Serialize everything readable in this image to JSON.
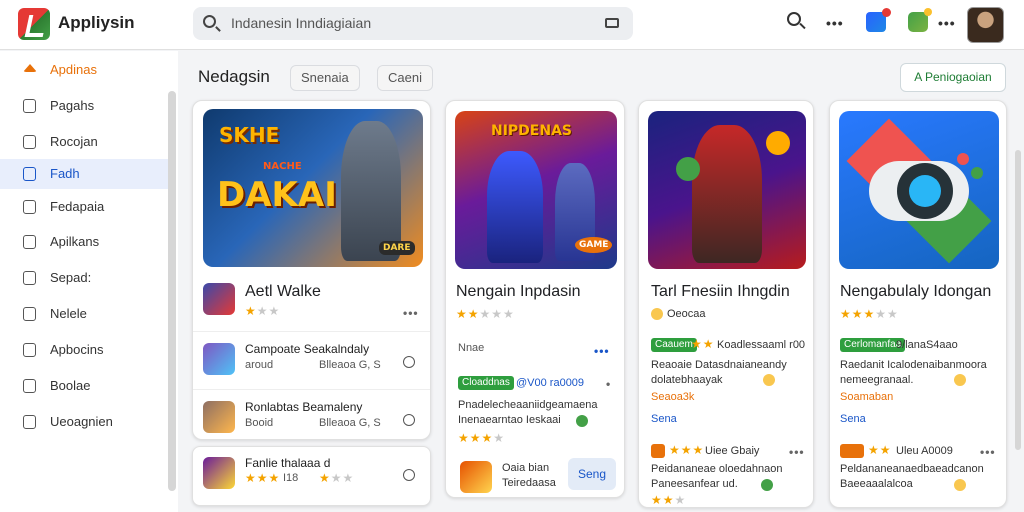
{
  "app": {
    "name": "Appliysin"
  },
  "search": {
    "value": "Indanesin Inndiagiaian"
  },
  "sidebar": {
    "items": [
      {
        "label": "Apdinas"
      },
      {
        "label": "Pagahs"
      },
      {
        "label": "Rocojan"
      },
      {
        "label": "Fadh"
      },
      {
        "label": "Fedapaia"
      },
      {
        "label": "Apilkans"
      },
      {
        "label": "Sepad:"
      },
      {
        "label": "Nelele"
      },
      {
        "label": "Apbocins"
      },
      {
        "label": "Boolae"
      },
      {
        "label": "Ueoagnien"
      }
    ]
  },
  "main": {
    "title": "Nedagsin",
    "chips": [
      "Snenaia",
      "Caeni"
    ],
    "create_button": "A Peniogaoian"
  },
  "cards": [
    {
      "banner_title": "DAKAI",
      "banner_tag": "SKHE",
      "banner_sub": "NACHE",
      "corner": "DARE",
      "title": "Aetl Walke",
      "rows": [
        {
          "title": "Campoate Seakalndaly",
          "sub1": "aroud",
          "sub2": "Blleaoa G, S"
        },
        {
          "title": "Ronlabtas Beamaleny",
          "sub1": "Booid",
          "sub2": "Blleaoa G, S"
        },
        {
          "title": "Fanlie thalaaa d",
          "sub1": "I18",
          "sub2": ""
        }
      ]
    },
    {
      "banner_title": "NIPDENAS",
      "corner": "GAME",
      "title": "Nengain Inpdasin",
      "meta": "Nnae",
      "badge": "Cloaddnas",
      "badge_info": "@V00 ra0009",
      "desc1": "Pnadelecheaaniidgeamaena",
      "desc2": "Inenaearntao Ieskaai",
      "bottom_text1": "Oaia bian",
      "bottom_text2": "Teiredaasa",
      "install": "Seng"
    },
    {
      "title": "Tarl Fnesiin Ihngdin",
      "meta": "Oeocaa",
      "badge": "Caauem",
      "badge_info": "Koadlessaaml r00",
      "desc1": "Reaoaie Datasdnaianeandy",
      "desc2": "dolatebhaayak",
      "link": "Seaoa3k",
      "link2": "Sena",
      "bottom_badge": "",
      "bottom_info": "Uiee Gbaiy",
      "bottom_desc1": "Peidananeae oloedahnaon",
      "bottom_desc2": "Paneesanfear ud."
    },
    {
      "title": "Nengabulaly Idongan",
      "badge": "Cerlomanfaa",
      "badge_info": "9/lanaS4aao",
      "desc1": "Raedanit Icalodenaibanmoora",
      "desc2": "nemeegranaal.",
      "link": "Soamaban",
      "link2": "Sena",
      "bottom_badge": "",
      "bottom_info": "Uleu A0009",
      "bottom_desc1": "Peldananeanaedbaeadcanon",
      "bottom_desc2": "Baeeaaalalcoa"
    }
  ],
  "colors": {
    "accent_blue": "#1a56c8",
    "accent_orange": "#e8710a",
    "accent_green": "#2e9e3e",
    "star": "#f4a300"
  }
}
